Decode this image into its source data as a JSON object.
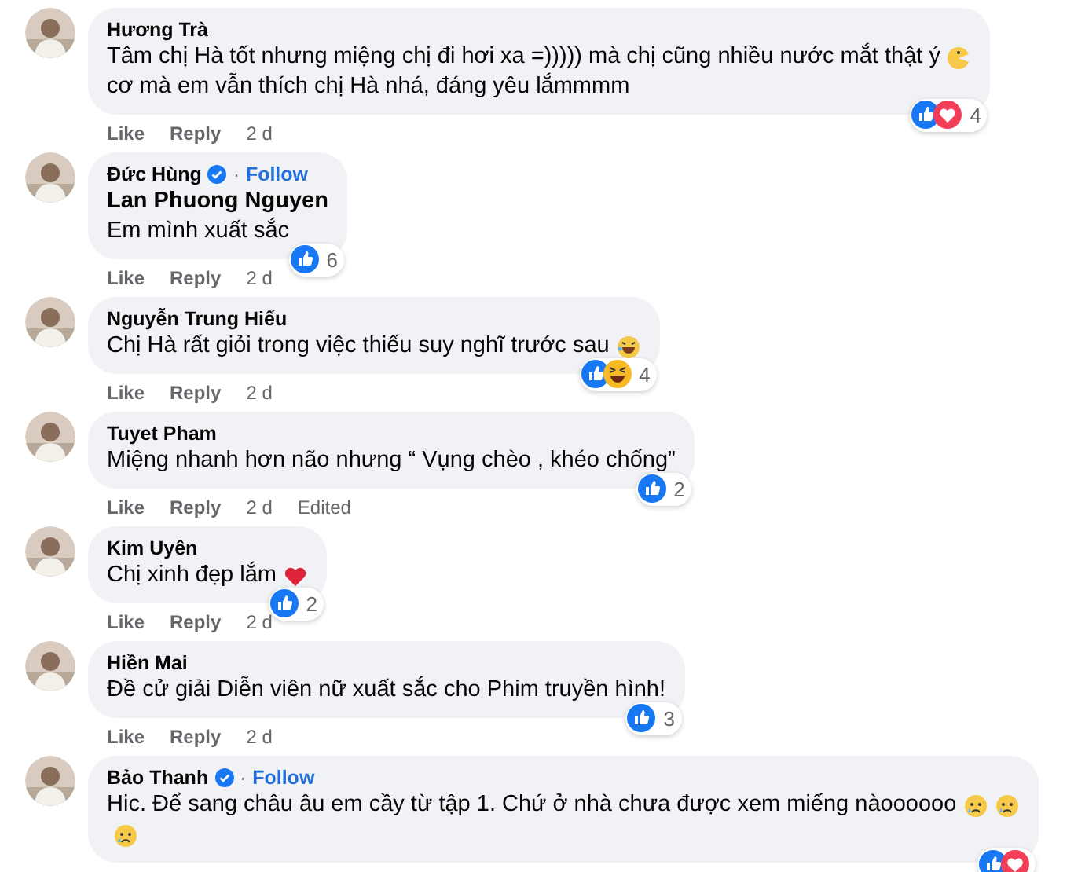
{
  "comments": [
    {
      "name": "Hương Trà",
      "verified": false,
      "lines": [
        {
          "text": "Tâm chị Hà tốt nhưng miệng chị đi hơi xa =))))) mà chị cũng nhiều nước mắt thật ý",
          "emojis": [
            {
              "kind": "pacman"
            }
          ]
        },
        {
          "text": "cơ mà em vẫn thích chị Hà nhá, đáng yêu lắmmmm"
        }
      ],
      "reactions": [
        {
          "kind": "like"
        },
        {
          "kind": "love"
        }
      ],
      "count": "4",
      "actions": [
        "Like",
        "Reply"
      ],
      "time": "2 d"
    },
    {
      "name": "Đức Hùng",
      "verified": true,
      "separator": "·",
      "follow": "Follow",
      "mention": "Lan Phuong Nguyen",
      "lines": [
        {
          "text": "Em mình xuất sắc"
        }
      ],
      "reactions": [
        {
          "kind": "like"
        }
      ],
      "count": "6",
      "actions": [
        "Like",
        "Reply"
      ],
      "time": "2 d"
    },
    {
      "name": "Nguyễn Trung Hiếu",
      "verified": false,
      "lines": [
        {
          "text": "Chị Hà rất giỏi trong việc thiếu suy nghĩ trước sau",
          "emojis": [
            {
              "kind": "laugh"
            }
          ]
        }
      ],
      "reactions": [
        {
          "kind": "like"
        },
        {
          "kind": "haha"
        }
      ],
      "count": "4",
      "actions": [
        "Like",
        "Reply"
      ],
      "time": "2 d"
    },
    {
      "name": "Tuyet Pham",
      "verified": false,
      "lines": [
        {
          "text": "Miệng nhanh hơn não nhưng “ Vụng chèo , khéo chống”"
        }
      ],
      "reactions": [
        {
          "kind": "like"
        }
      ],
      "count": "2",
      "actions": [
        "Like",
        "Reply"
      ],
      "time": "2 d",
      "edited": "Edited"
    },
    {
      "name": "Kim Uyên",
      "verified": false,
      "lines": [
        {
          "text": "Chị xinh đẹp lắm",
          "emojis": [
            {
              "kind": "heart"
            }
          ]
        }
      ],
      "reactions": [
        {
          "kind": "like"
        }
      ],
      "count": "2",
      "actions": [
        "Like",
        "Reply"
      ],
      "time": "2 d"
    },
    {
      "name": "Hiền Mai",
      "verified": false,
      "lines": [
        {
          "text": "Đề cử giải Diễn viên nữ xuất sắc cho Phim truyền hình!"
        }
      ],
      "reactions": [
        {
          "kind": "like"
        }
      ],
      "count": "3",
      "actions": [
        "Like",
        "Reply"
      ],
      "time": "2 d"
    },
    {
      "name": "Bảo Thanh",
      "verified": true,
      "separator": "·",
      "follow": "Follow",
      "lines": [
        {
          "text": "Hic. Để sang châu âu em cầy từ tập 1. Chứ ở nhà chưa được xem miếng nàoooooo",
          "emojis": [
            {
              "kind": "sad"
            },
            {
              "kind": "sad"
            }
          ]
        },
        {
          "emojis": [
            {
              "kind": "sad"
            }
          ]
        }
      ],
      "reactions": [
        {
          "kind": "like"
        },
        {
          "kind": "love"
        }
      ]
    }
  ]
}
